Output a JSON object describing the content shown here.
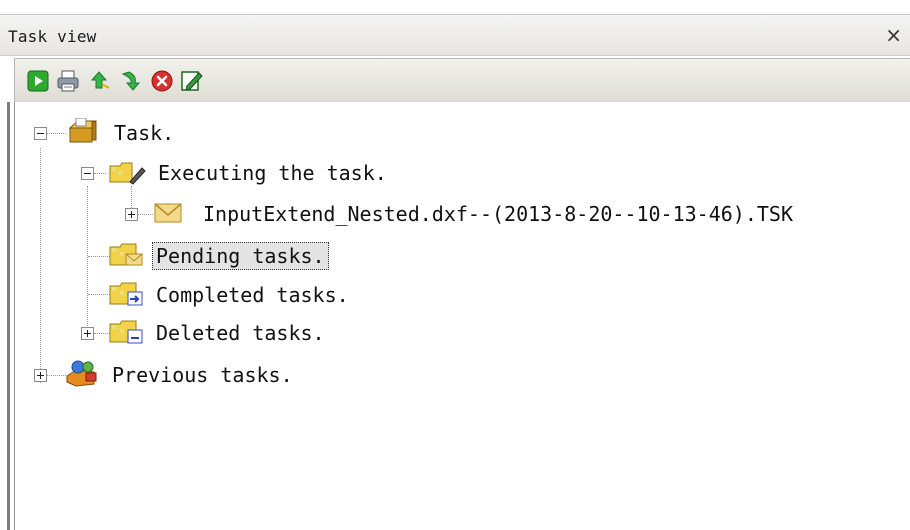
{
  "panel": {
    "title": "Task view",
    "close_symbol": "×"
  },
  "toolbar": {
    "buttons": [
      {
        "icon": "start-icon"
      },
      {
        "icon": "print-icon"
      },
      {
        "icon": "move-up-icon"
      },
      {
        "icon": "move-down-icon"
      },
      {
        "icon": "delete-icon"
      },
      {
        "icon": "edit-icon"
      }
    ]
  },
  "tree": {
    "root": {
      "label": "Task.",
      "expanded": true
    },
    "executing": {
      "label": "Executing the task.",
      "expanded": true
    },
    "file": {
      "label": "InputExtend_Nested.dxf--(2013-8-20--10-13-46).TSK",
      "expanded": false
    },
    "pending": {
      "label": "Pending tasks.",
      "selected": true
    },
    "completed": {
      "label": "Completed tasks."
    },
    "deleted": {
      "label": "Deleted tasks.",
      "expanded": false
    },
    "previous": {
      "label": "Previous tasks.",
      "expanded": false
    }
  },
  "colors": {
    "selection_bg": "#e4e4e4",
    "toolbar_bg": "#e9e8e2"
  }
}
